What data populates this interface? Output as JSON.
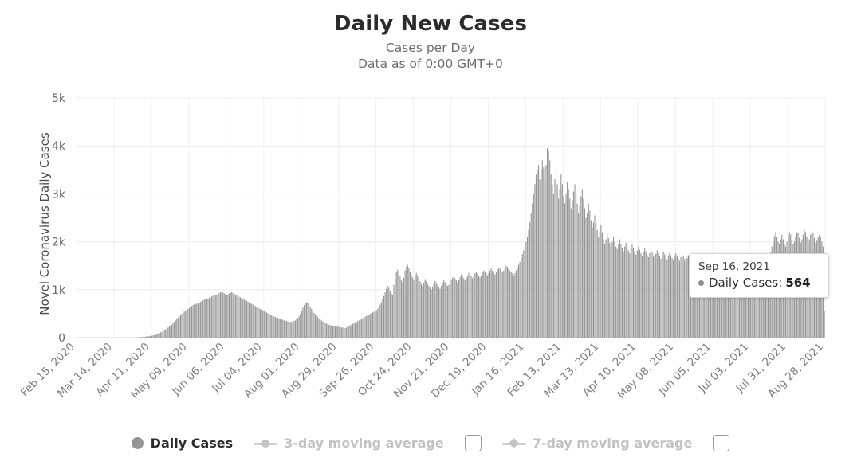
{
  "header": {
    "title": "Daily New Cases",
    "subtitle": "Cases per Day",
    "subtitle2": "Data as of 0:00 GMT+0"
  },
  "tooltip": {
    "date": "Sep 16, 2021",
    "series_label": "Daily Cases:",
    "value": "564",
    "dot_color": "#8d8d8d"
  },
  "legend": {
    "items": [
      {
        "label": "Daily Cases",
        "marker": "circle-dot-icon",
        "state": "active",
        "color": "#969696"
      },
      {
        "label": "3-day moving average",
        "marker": "line-circle-icon",
        "state": "inactive",
        "color": "#c4c4c4"
      },
      {
        "label": "7-day moving average",
        "marker": "line-diamond-icon",
        "state": "inactive",
        "color": "#c4c4c4"
      }
    ],
    "checkbox_label": ""
  },
  "chart_data": {
    "type": "bar",
    "title": "Daily New Cases",
    "subtitle": "Cases per Day",
    "xlabel": "",
    "ylabel": "Novel Coronavirus Daily Cases",
    "ylim": [
      0,
      5000
    ],
    "yticks": [
      0,
      1000,
      2000,
      3000,
      4000,
      5000
    ],
    "ytick_labels": [
      "0",
      "1k",
      "2k",
      "3k",
      "4k",
      "5k"
    ],
    "grid": true,
    "legend_position": "bottom",
    "bar_color": "#969696",
    "xtick_labels": [
      "Feb 15, 2020",
      "Mar 14, 2020",
      "Apr 11, 2020",
      "May 09, 2020",
      "Jun 06, 2020",
      "Jul 04, 2020",
      "Aug 01, 2020",
      "Aug 29, 2020",
      "Sep 26, 2020",
      "Oct 24, 2020",
      "Nov 21, 2020",
      "Dec 19, 2020",
      "Jan 16, 2021",
      "Feb 13, 2021",
      "Mar 13, 2021",
      "Apr 10, 2021",
      "May 08, 2021",
      "Jun 05, 2021",
      "Jul 03, 2021",
      "Jul 31, 2021",
      "Aug 28, 2021"
    ],
    "x_start": "Feb 15, 2020",
    "x_end": "Sep 16, 2021",
    "n_points": 580,
    "values": [
      0,
      0,
      0,
      0,
      0,
      0,
      0,
      0,
      0,
      0,
      0,
      0,
      0,
      0,
      0,
      0,
      0,
      0,
      0,
      0,
      0,
      0,
      0,
      0,
      0,
      0,
      0,
      0,
      0,
      0,
      0,
      0,
      0,
      0,
      0,
      0,
      0,
      0,
      0,
      0,
      0,
      0,
      0,
      0,
      0,
      0,
      2,
      3,
      5,
      4,
      8,
      10,
      14,
      12,
      18,
      22,
      26,
      30,
      28,
      35,
      40,
      52,
      48,
      60,
      72,
      85,
      95,
      110,
      120,
      135,
      150,
      170,
      190,
      210,
      230,
      250,
      270,
      300,
      330,
      360,
      390,
      420,
      440,
      470,
      500,
      520,
      545,
      560,
      580,
      600,
      620,
      640,
      660,
      680,
      700,
      690,
      710,
      730,
      720,
      745,
      760,
      775,
      790,
      805,
      820,
      810,
      830,
      845,
      860,
      875,
      890,
      880,
      900,
      915,
      930,
      945,
      955,
      940,
      925,
      910,
      895,
      905,
      920,
      935,
      948,
      930,
      912,
      900,
      885,
      870,
      855,
      840,
      825,
      810,
      795,
      780,
      765,
      750,
      735,
      720,
      705,
      690,
      675,
      660,
      645,
      630,
      615,
      600,
      585,
      570,
      555,
      540,
      525,
      510,
      495,
      480,
      465,
      450,
      440,
      430,
      420,
      410,
      400,
      390,
      380,
      370,
      360,
      350,
      345,
      340,
      335,
      330,
      325,
      330,
      345,
      360,
      380,
      410,
      450,
      500,
      560,
      620,
      680,
      720,
      740,
      720,
      680,
      640,
      600,
      560,
      520,
      490,
      460,
      430,
      400,
      380,
      360,
      340,
      320,
      300,
      290,
      280,
      270,
      260,
      255,
      250,
      245,
      240,
      235,
      230,
      225,
      220,
      215,
      210,
      205,
      200,
      210,
      225,
      240,
      255,
      270,
      285,
      300,
      315,
      330,
      345,
      360,
      375,
      390,
      405,
      420,
      435,
      450,
      465,
      480,
      495,
      510,
      525,
      540,
      555,
      570,
      600,
      640,
      690,
      740,
      800,
      870,
      950,
      1020,
      1080,
      1040,
      980,
      920,
      880,
      1100,
      1250,
      1380,
      1420,
      1350,
      1280,
      1200,
      1150,
      1250,
      1400,
      1480,
      1520,
      1450,
      1380,
      1300,
      1250,
      1200,
      1280,
      1350,
      1300,
      1250,
      1180,
      1120,
      1080,
      1150,
      1220,
      1180,
      1120,
      1080,
      1040,
      1000,
      1060,
      1120,
      1180,
      1140,
      1100,
      1060,
      1020,
      1080,
      1140,
      1200,
      1160,
      1120,
      1080,
      1100,
      1150,
      1200,
      1250,
      1280,
      1240,
      1200,
      1160,
      1200,
      1260,
      1320,
      1280,
      1240,
      1200,
      1240,
      1300,
      1350,
      1320,
      1280,
      1240,
      1280,
      1340,
      1380,
      1340,
      1300,
      1260,
      1300,
      1360,
      1400,
      1380,
      1340,
      1300,
      1340,
      1400,
      1440,
      1400,
      1360,
      1320,
      1360,
      1420,
      1460,
      1440,
      1400,
      1360,
      1400,
      1460,
      1500,
      1480,
      1440,
      1400,
      1380,
      1340,
      1300,
      1340,
      1400,
      1460,
      1520,
      1580,
      1660,
      1740,
      1820,
      1900,
      2000,
      2100,
      2250,
      2400,
      2600,
      2800,
      3000,
      3200,
      3400,
      3500,
      3600,
      3300,
      3500,
      3700,
      3550,
      3300,
      3600,
      3950,
      3900,
      3700,
      3400,
      3200,
      3000,
      3300,
      3500,
      3200,
      2900,
      3100,
      3400,
      3200,
      2950,
      2800,
      3000,
      3250,
      3100,
      2900,
      2700,
      2850,
      3050,
      3200,
      3000,
      2800,
      2600,
      2750,
      2950,
      3100,
      2900,
      2700,
      2500,
      2600,
      2800,
      2650,
      2450,
      2300,
      2400,
      2550,
      2400,
      2250,
      2100,
      2200,
      2350,
      2200,
      2050,
      1950,
      2050,
      2180,
      2080,
      1980,
      1900,
      2000,
      2100,
      2000,
      1900,
      1850,
      1950,
      2050,
      1950,
      1870,
      1800,
      1900,
      1980,
      1900,
      1820,
      1760,
      1850,
      1950,
      1870,
      1790,
      1730,
      1820,
      1900,
      1830,
      1760,
      1700,
      1790,
      1870,
      1800,
      1730,
      1680,
      1760,
      1840,
      1780,
      1720,
      1670,
      1750,
      1820,
      1760,
      1700,
      1650,
      1730,
      1800,
      1740,
      1680,
      1630,
      1710,
      1780,
      1720,
      1660,
      1610,
      1690,
      1760,
      1700,
      1650,
      1600,
      1680,
      1740,
      1690,
      1640,
      1590,
      1660,
      1720,
      1670,
      1620,
      1570,
      1640,
      1700,
      1650,
      1600,
      1550,
      1620,
      1680,
      1630,
      1580,
      1530,
      1600,
      1650,
      1600,
      1550,
      1500,
      1560,
      1600,
      1550,
      1500,
      1450,
      1500,
      1540,
      1490,
      1440,
      1390,
      1430,
      1460,
      1410,
      1360,
      1320,
      1360,
      1400,
      1350,
      1300,
      1260,
      1300,
      1340,
      1290,
      1250,
      1210,
      1250,
      1290,
      1240,
      1200,
      1160,
      1200,
      1240,
      1190,
      1150,
      1110,
      1150,
      1190,
      1140,
      1100,
      1070,
      1110,
      1160,
      1220,
      1300,
      1400,
      1520,
      1650,
      1780,
      1900,
      2000,
      2120,
      2200,
      2100,
      2000,
      1950,
      2050,
      2150,
      2050,
      1950,
      1900,
      2000,
      2100,
      2200,
      2150,
      2050,
      1950,
      2000,
      2100,
      2200,
      2180,
      2080,
      1980,
      2050,
      2150,
      2250,
      2200,
      2100,
      2000,
      2050,
      2150,
      2220,
      2180,
      2080,
      1980,
      2020,
      2100,
      2150,
      2100,
      2000,
      1900,
      564
    ]
  }
}
